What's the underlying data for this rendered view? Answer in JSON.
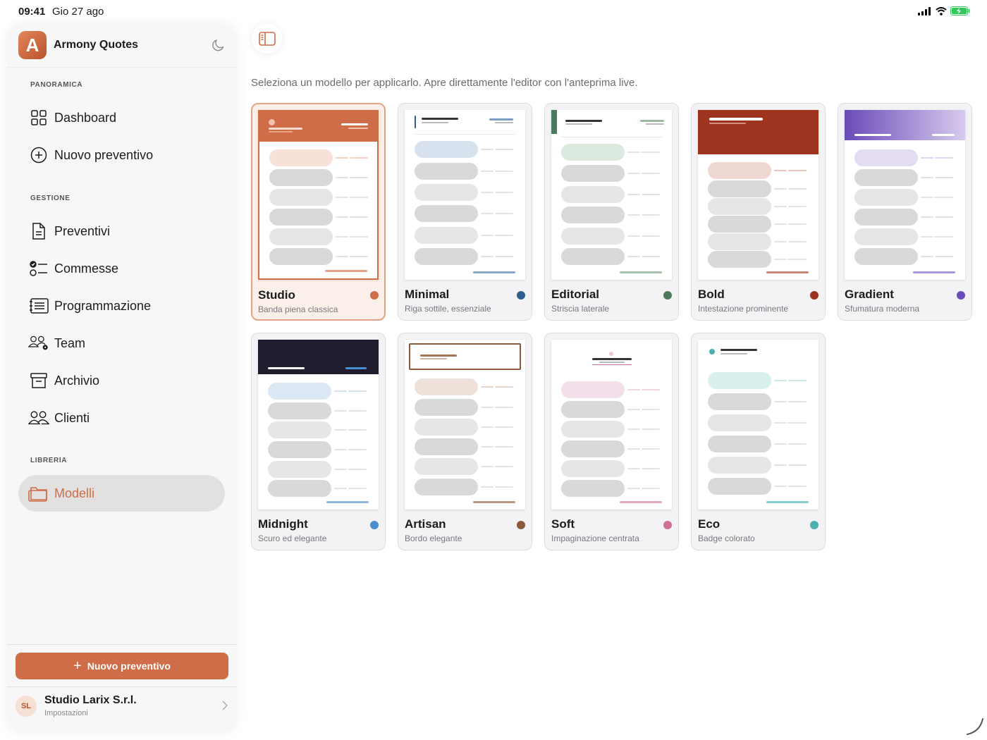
{
  "status_bar": {
    "time": "09:41",
    "date": "Gio 27 ago"
  },
  "sidebar": {
    "app_title": "Armony Quotes",
    "logo_letter": "A",
    "sections": {
      "overview": "PANORAMICA",
      "management": "GESTIONE",
      "library": "LIBRERIA"
    },
    "items": [
      {
        "label": "Dashboard",
        "icon": "grid-icon"
      },
      {
        "label": "Nuovo preventivo",
        "icon": "plus-circle-icon"
      },
      {
        "label": "Preventivi",
        "icon": "document-icon"
      },
      {
        "label": "Commesse",
        "icon": "checklist-icon"
      },
      {
        "label": "Programmazione",
        "icon": "schedule-icon"
      },
      {
        "label": "Team",
        "icon": "team-gear-icon"
      },
      {
        "label": "Archivio",
        "icon": "archive-icon"
      },
      {
        "label": "Clienti",
        "icon": "people-icon"
      },
      {
        "label": "Modelli",
        "icon": "templates-icon",
        "active": true
      }
    ],
    "cta_label": "Nuovo preventivo",
    "account": {
      "initials": "SL",
      "name": "Studio Larix S.r.l.",
      "subtitle": "Impostazioni"
    }
  },
  "main": {
    "subtitle": "Seleziona un modello per applicarlo. Apre direttamente l'editor con l'anteprima live.",
    "templates": [
      {
        "name": "Studio",
        "description": "Banda piena classica",
        "color": "#cf6d48",
        "selected": true
      },
      {
        "name": "Minimal",
        "description": "Riga sottile, essenziale",
        "color": "#2f5d8f"
      },
      {
        "name": "Editorial",
        "description": "Striscia laterale",
        "color": "#4a7a5b"
      },
      {
        "name": "Bold",
        "description": "Intestazione prominente",
        "color": "#9e3320"
      },
      {
        "name": "Gradient",
        "description": "Sfumatura moderna",
        "color": "#6a4bb8"
      },
      {
        "name": "Midnight",
        "description": "Scuro ed elegante",
        "color": "#4a8fd0"
      },
      {
        "name": "Artisan",
        "description": "Bordo elegante",
        "color": "#8b5a3c"
      },
      {
        "name": "Soft",
        "description": "Impaginazione centrata",
        "color": "#cf6f98"
      },
      {
        "name": "Eco",
        "description": "Badge colorato",
        "color": "#4ab0b0"
      }
    ]
  }
}
